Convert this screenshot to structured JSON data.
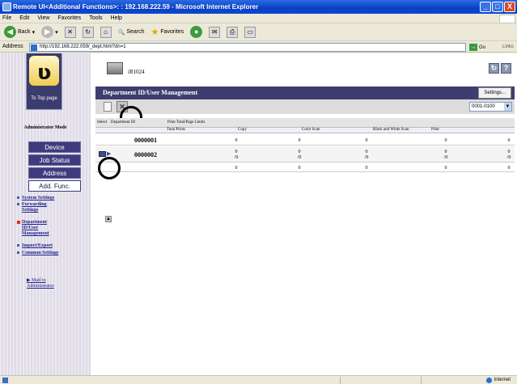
{
  "window": {
    "title": "Remote UI<Additional Functions>: : 192.168.222.59 - Microsoft Internet Explorer",
    "buttons": [
      "_",
      "□",
      "X"
    ]
  },
  "menu": [
    "File",
    "Edit",
    "View",
    "Favorites",
    "Tools",
    "Help"
  ],
  "toolbar": {
    "back": "Back",
    "search": "Search",
    "favorites": "Favorites"
  },
  "address": {
    "label": "Address",
    "url": "http://192.168.222.059/_dept.html?dn=1",
    "go": "Go",
    "links": "Links"
  },
  "sidebar": {
    "to_top": "To Top page",
    "admin_mode": "Administrator Mode",
    "nav": [
      "Device",
      "Job Status",
      "Address",
      "Add. Func."
    ],
    "active_nav": "Add. Func.",
    "sub": [
      {
        "label": "System Settings"
      },
      {
        "label": "Forwarding Settings"
      },
      {
        "label": "Department ID/User Management",
        "active": true
      },
      {
        "label": "Import/Export"
      },
      {
        "label": "Common Settings"
      }
    ],
    "mail_to": "Mail to Administrator"
  },
  "main": {
    "model": "iR1024",
    "section_title": "Department ID/User Management",
    "settings_button": "Settings...",
    "range_select": "0001-0100",
    "table": {
      "col_select": "Select",
      "col_dept": "Department ID",
      "group_header": "Print Total/Page Limits",
      "subcols": [
        "Total Prints",
        "Copy",
        "Color Scan",
        "Black and White Scan",
        "Print"
      ],
      "rows": [
        {
          "id": "0000001",
          "values": [
            "0",
            "0",
            "0",
            "0",
            "0",
            "0"
          ]
        },
        {
          "id": "0000002",
          "values": [
            "0",
            "0",
            "0",
            "0",
            "0",
            "0"
          ],
          "limits": [
            "/0",
            "/0",
            "/0",
            "/0",
            "/0"
          ]
        },
        {
          "id": "",
          "values": [
            "0",
            "0",
            "0",
            "0",
            "0",
            "0"
          ]
        }
      ]
    }
  },
  "status": {
    "zone": "Internet"
  }
}
